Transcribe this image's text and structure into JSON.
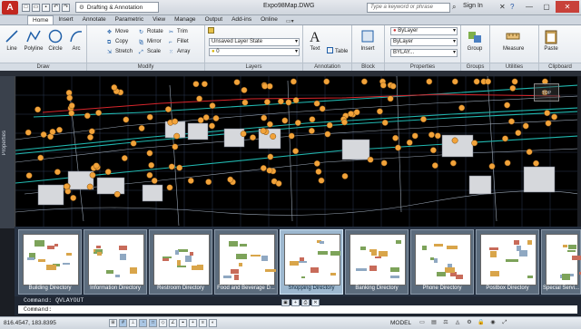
{
  "titlebar": {
    "app_logo": "A",
    "workspace": "Drafting & Annotation",
    "title": "Expo98Map.DWG",
    "search_placeholder": "Type a keyword or phrase",
    "sign_in": "Sign In"
  },
  "tabs": [
    "Home",
    "Insert",
    "Annotate",
    "Parametric",
    "View",
    "Manage",
    "Output",
    "Add-ins",
    "Online"
  ],
  "active_tab": "Home",
  "ribbon": {
    "draw": {
      "title": "Draw",
      "tools": [
        "Line",
        "Polyline",
        "Circle",
        "Arc"
      ]
    },
    "modify": {
      "title": "Modify",
      "tools": [
        "Move",
        "Rotate",
        "Trim",
        "Copy",
        "Mirror",
        "Fillet",
        "Stretch",
        "Scale",
        "Array"
      ]
    },
    "layers": {
      "title": "Layers",
      "layer_state": "Unsaved Layer State",
      "current_layer": "0"
    },
    "annotation": {
      "title": "Annotation",
      "text": "Text",
      "table": "Table"
    },
    "block": {
      "title": "Block",
      "insert": "Insert"
    },
    "properties": {
      "title": "Properties",
      "color": "ByLayer",
      "lineweight": "ByLayer",
      "linetype": "BYLAY..."
    },
    "groups": {
      "title": "Groups",
      "group": "Group"
    },
    "utilities": {
      "title": "Utilities",
      "measure": "Measure"
    },
    "clipboard": {
      "title": "Clipboard",
      "paste": "Paste"
    }
  },
  "side_palette_label": "Properties",
  "viewcube_label": "TOP",
  "layouts": [
    "Building Directory",
    "Information Directory",
    "Restroom Directory",
    "Food and Beverage D...",
    "Shopping Directory",
    "Banking Directory",
    "Phone Directory",
    "Postbox Directory",
    "Special Servi..."
  ],
  "active_layout": "Shopping Directory",
  "command": {
    "history": "Command: QVLAYOUT",
    "prompt": "Command:"
  },
  "status": {
    "coords": "816.4547, 183.8395",
    "model": "MODEL"
  },
  "colors": {
    "canvas": "#000000",
    "marker": "#f2a33a",
    "street": "#21b8b0",
    "boundary": "#d8262c",
    "grid": "#2c3a52"
  }
}
